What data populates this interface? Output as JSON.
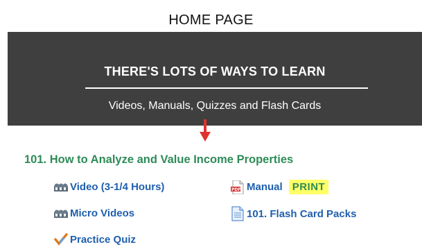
{
  "page": {
    "title": "HOME PAGE"
  },
  "banner": {
    "heading": "THERE'S LOTS OF WAYS TO LEARN",
    "subheading": "Videos, Manuals, Quizzes and Flash Cards"
  },
  "course": {
    "title": "101. How to Analyze and Value Income Properties",
    "links": {
      "video": "Video (3-1/4 Hours)",
      "micro_videos": "Micro Videos",
      "practice_quiz": "Practice Quiz",
      "manual": "Manual",
      "print": "PRINT",
      "flash_cards": "101. Flash Card Packs"
    }
  },
  "colors": {
    "banner_bg": "#3f3f3f",
    "course_title": "#2e8b57",
    "link": "#1f5fad",
    "arrow": "#e0332e",
    "print_highlight": "#ffff66"
  },
  "icons": {
    "video": "film-reel-icon",
    "micro_videos": "film-reel-icon",
    "practice_quiz": "checkmark-pencil-icon",
    "manual": "pdf-document-icon",
    "flash_cards": "document-icon",
    "pointer": "down-arrow-icon"
  }
}
